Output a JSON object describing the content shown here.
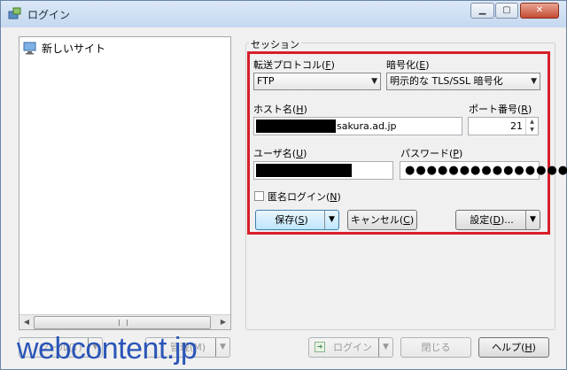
{
  "window": {
    "title": "ログイン"
  },
  "tree": {
    "items": [
      {
        "label": "新しいサイト",
        "icon": "site-monitor-icon"
      }
    ]
  },
  "session": {
    "group_label": "セッション",
    "protocol": {
      "label": "転送プロトコル",
      "accel": "F",
      "value": "FTP"
    },
    "encryption": {
      "label": "暗号化",
      "accel": "E",
      "value": "明示的な TLS/SSL 暗号化"
    },
    "host": {
      "label": "ホスト名",
      "accel": "H",
      "value_suffix": "sakura.ad.jp"
    },
    "port": {
      "label": "ポート番号",
      "accel": "R",
      "value": "21"
    },
    "user": {
      "label": "ユーザ名",
      "accel": "U"
    },
    "password": {
      "label": "パスワード",
      "accel": "P",
      "value": "●●●●●●●●●●●●●●●●"
    },
    "anonymous": {
      "label": "匿名ログイン",
      "accel": "N",
      "checked": false
    },
    "save_button": {
      "label": "保存",
      "accel": "S"
    },
    "cancel_button": {
      "label": "キャンセル",
      "accel": "C"
    },
    "settings_button": {
      "label": "設定",
      "accel": "D",
      "suffix": "..."
    }
  },
  "footer": {
    "tools_button": {
      "label": "ツール(T)"
    },
    "manage_button": {
      "label": "管理(M)"
    },
    "login_button": {
      "label": "ログイン"
    },
    "close_button": {
      "label": "閉じる"
    },
    "help_button": {
      "label": "ヘルプ",
      "accel": "H"
    }
  },
  "watermark": "webcontent.jp",
  "colors": {
    "highlight": "#d81e2a",
    "watermark": "#2a55b8"
  }
}
